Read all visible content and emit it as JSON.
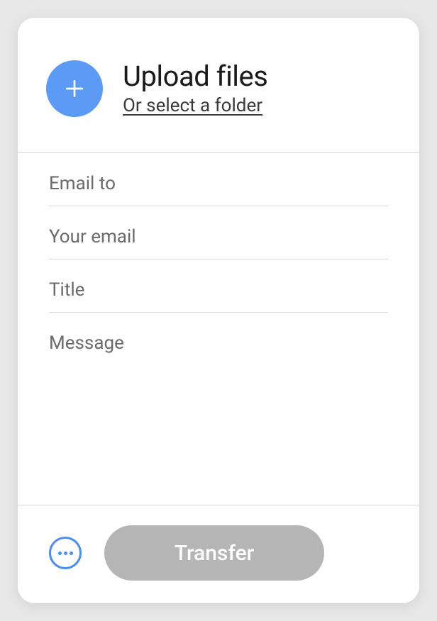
{
  "upload": {
    "title": "Upload files",
    "subtitle": "Or select a folder"
  },
  "fields": {
    "email_to_placeholder": "Email to",
    "your_email_placeholder": "Your email",
    "title_placeholder": "Title",
    "message_placeholder": "Message"
  },
  "footer": {
    "transfer_label": "Transfer"
  }
}
